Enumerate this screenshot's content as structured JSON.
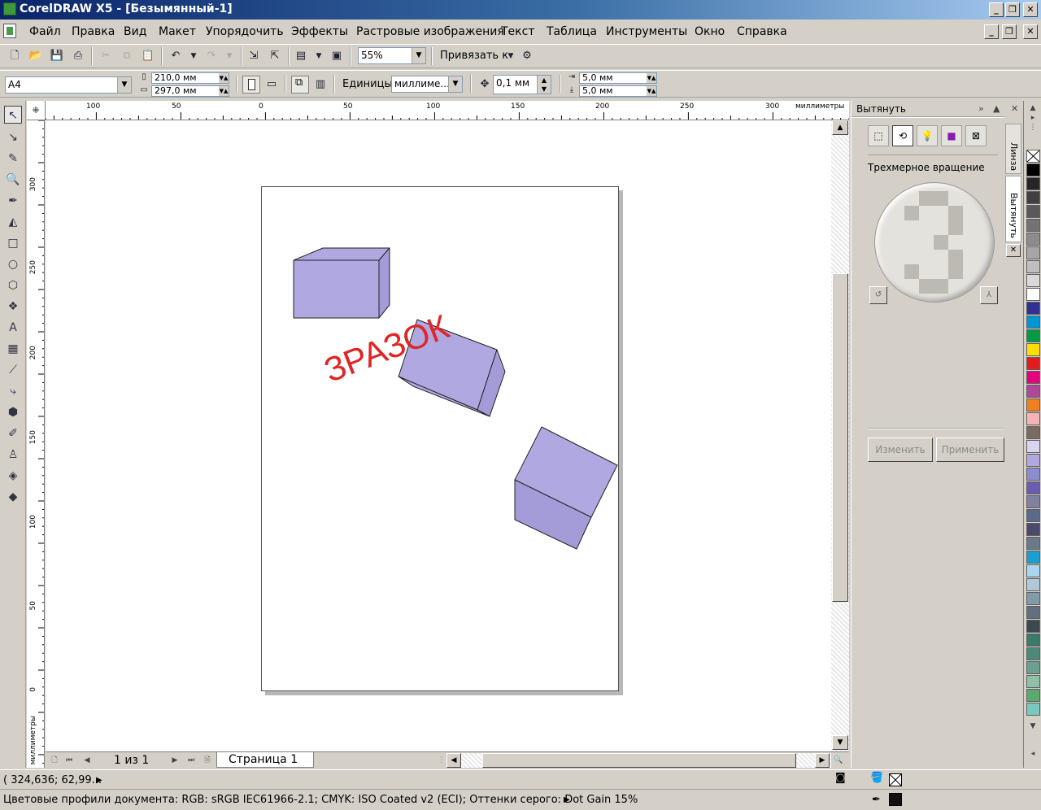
{
  "window": {
    "title": "CorelDRAW X5 - [Безымянный-1]"
  },
  "menu": [
    "Файл",
    "Правка",
    "Вид",
    "Макет",
    "Упорядочить",
    "Эффекты",
    "Растровые изображения",
    "Текст",
    "Таблица",
    "Инструменты",
    "Окно",
    "Справка"
  ],
  "toolbar": {
    "zoom": "55%",
    "snap_label": "Привязать к"
  },
  "property_bar": {
    "paper_size": "A4",
    "width": "210,0 мм",
    "height": "297,0 мм",
    "units_label": "Единицы:",
    "units_value": "миллиме...",
    "nudge": "0,1 мм",
    "dup_x": "5,0 мм",
    "dup_y": "5,0 мм"
  },
  "ruler": {
    "unit_label": "миллиметры",
    "h_ticks": [
      "100",
      "50",
      "0",
      "50",
      "100",
      "150",
      "200",
      "250",
      "300"
    ],
    "v_ticks": [
      "300",
      "250",
      "200",
      "150",
      "100",
      "50",
      "0"
    ],
    "v_unit_label": "миллиметры"
  },
  "canvas": {
    "watermark": "ЗРАЗОК",
    "shape_fill": "#b0a8e0",
    "shape_side": "#a49cd8"
  },
  "page_nav": {
    "count": "1 из 1",
    "tab": "Страница 1"
  },
  "docker": {
    "title": "Вытянуть",
    "section_label": "Трехмерное вращение",
    "edit_btn": "Изменить",
    "apply_btn": "Применить"
  },
  "side_tabs": [
    "Линза",
    "Вытянуть"
  ],
  "palette": [
    "#000000",
    "#262626",
    "#404040",
    "#595959",
    "#737373",
    "#8c8c8c",
    "#a6a6a6",
    "#bfbfbf",
    "#d9d9d9",
    "#ffffff",
    "#2e3192",
    "#0096d6",
    "#009a44",
    "#ffde00",
    "#e21b1b",
    "#e5007e",
    "#b0489a",
    "#f07f1f",
    "#f6b3b3",
    "#7b6a5f",
    "#d9d4f0",
    "#b0a8e0",
    "#8c8cd0",
    "#6a5cb0",
    "#8080a0",
    "#5a6a8a",
    "#4a4a6a",
    "#6a7a8a",
    "#1aa0d0",
    "#a8d8f0",
    "#b0c8d8",
    "#809aa8",
    "#607080",
    "#3a4a50",
    "#3a7a6a",
    "#4a8a7a",
    "#6aa090",
    "#90c0a8",
    "#5aaa70",
    "#7ac8c0"
  ],
  "status": {
    "coords": "( 324,636; 62,99...",
    "profiles": "Цветовые профили документа: RGB: sRGB IEC61966-2.1; CMYK: ISO Coated v2 (ECI); Оттенки серого: Dot Gain 15%"
  }
}
